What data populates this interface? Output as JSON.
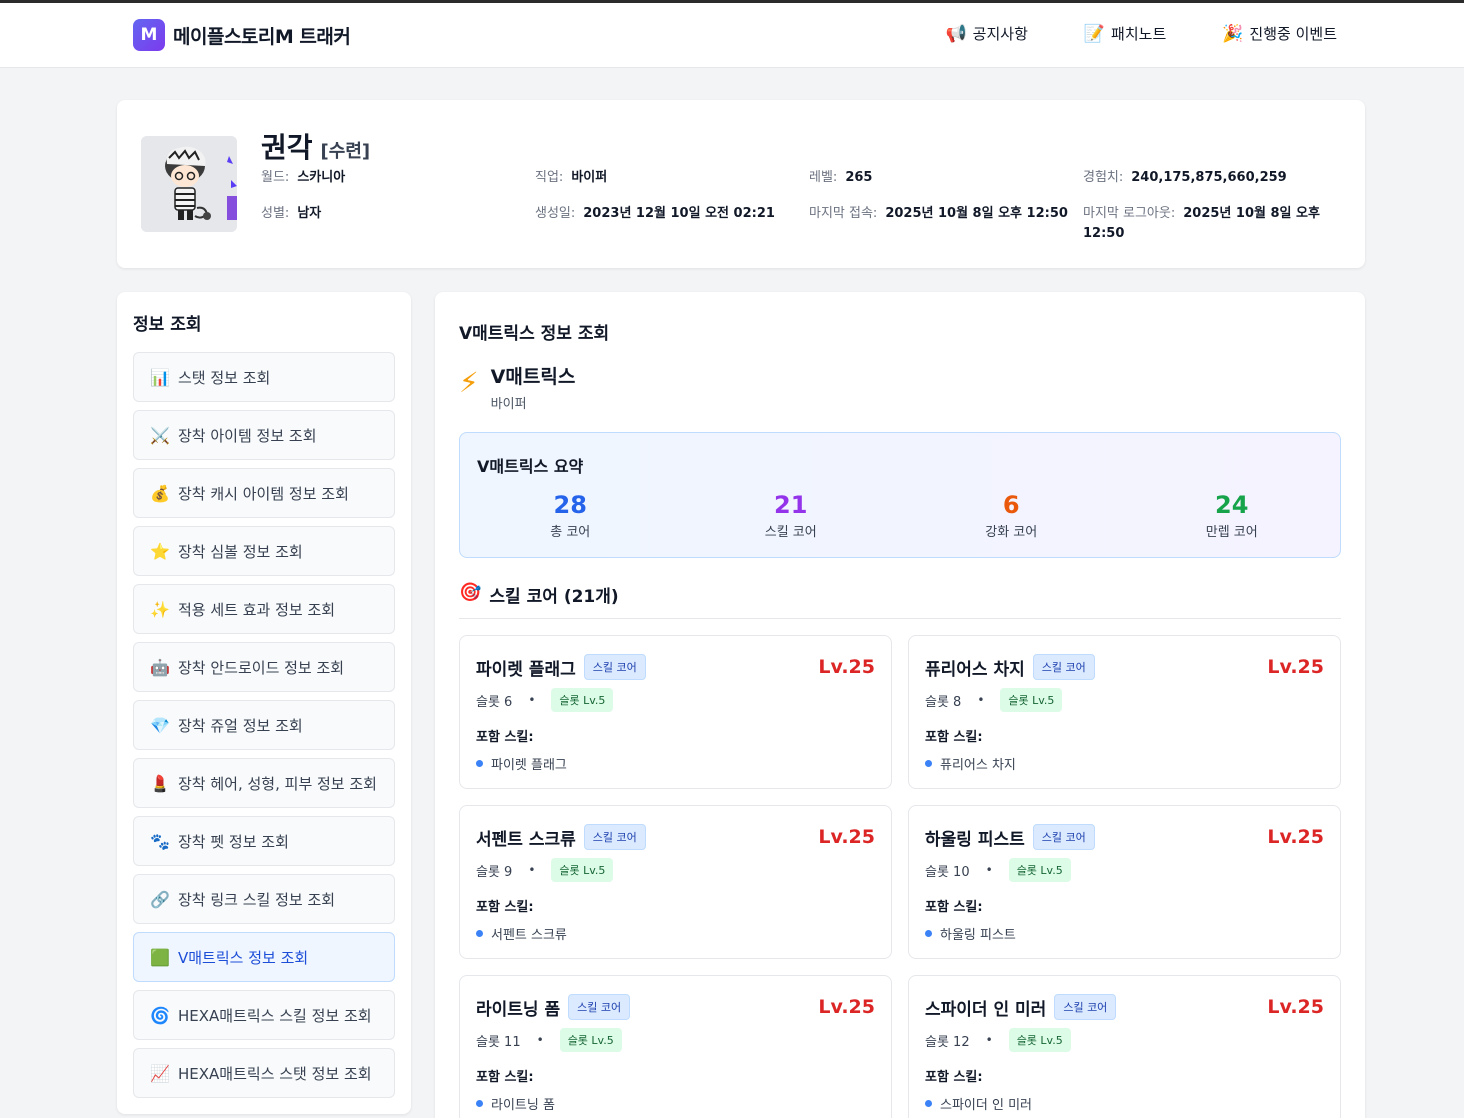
{
  "brand": {
    "logo": "M",
    "name": "메이플스토리M 트래커"
  },
  "nav": [
    {
      "icon": "📢",
      "label": "공지사항"
    },
    {
      "icon": "📝",
      "label": "패치노트"
    },
    {
      "icon": "🎉",
      "label": "진행중 이벤트"
    }
  ],
  "profile": {
    "name": "권각",
    "guild": "[수련]",
    "fields": [
      {
        "label": "월드:",
        "value": "스카니아"
      },
      {
        "label": "직업:",
        "value": "바이퍼"
      },
      {
        "label": "레벨:",
        "value": "265"
      },
      {
        "label": "경험치:",
        "value": "240,175,875,660,259"
      },
      {
        "label": "성별:",
        "value": "남자"
      },
      {
        "label": "생성일:",
        "value": "2023년 12월 10일 오전 02:21"
      },
      {
        "label": "마지막 접속:",
        "value": "2025년 10월 8일 오후 12:50"
      },
      {
        "label": "마지막 로그아웃:",
        "value": "2025년 10월 8일 오후 12:50"
      }
    ]
  },
  "sidebar": {
    "title": "정보 조회",
    "items": [
      {
        "icon": "📊",
        "label": "스탯 정보 조회"
      },
      {
        "icon": "⚔️",
        "label": "장착 아이템 정보 조회"
      },
      {
        "icon": "💰",
        "label": "장착 캐시 아이템 정보 조회"
      },
      {
        "icon": "⭐",
        "label": "장착 심볼 정보 조회"
      },
      {
        "icon": "✨",
        "label": "적용 세트 효과 정보 조회"
      },
      {
        "icon": "🤖",
        "label": "장착 안드로이드 정보 조회"
      },
      {
        "icon": "💎",
        "label": "장착 쥬얼 정보 조회"
      },
      {
        "icon": "💄",
        "label": "장착 헤어, 성형, 피부 정보 조회"
      },
      {
        "icon": "🐾",
        "label": "장착 펫 정보 조회"
      },
      {
        "icon": "🔗",
        "label": "장착 링크 스킬 정보 조회"
      },
      {
        "icon": "🟩",
        "label": "V매트릭스 정보 조회",
        "active": true
      },
      {
        "icon": "🌀",
        "label": "HEXA매트릭스 스킬 정보 조회"
      },
      {
        "icon": "📈",
        "label": "HEXA매트릭스 스탯 정보 조회"
      }
    ]
  },
  "main": {
    "title": "V매트릭스 정보 조회",
    "vm_title": "V매트릭스",
    "vm_sub": "바이퍼",
    "summary": {
      "title": "V매트릭스 요약",
      "stats": [
        {
          "value": "28",
          "label": "총 코어",
          "color": "#2563eb"
        },
        {
          "value": "21",
          "label": "스킬 코어",
          "color": "#9333ea"
        },
        {
          "value": "6",
          "label": "강화 코어",
          "color": "#ea580c"
        },
        {
          "value": "24",
          "label": "만렙 코어",
          "color": "#16a34a"
        }
      ]
    },
    "section_icon": "🎯",
    "section_title": "스킬 코어 (21개)",
    "cores": [
      {
        "name": "파이렛 플래그",
        "type": "스킬 코어",
        "level": "Lv.25",
        "slot": "슬롯 6",
        "slot_level": "슬롯 Lv.5",
        "skills_label": "포함 스킬:",
        "skill": "파이렛 플래그"
      },
      {
        "name": "퓨리어스 차지",
        "type": "스킬 코어",
        "level": "Lv.25",
        "slot": "슬롯 8",
        "slot_level": "슬롯 Lv.5",
        "skills_label": "포함 스킬:",
        "skill": "퓨리어스 차지"
      },
      {
        "name": "서펜트 스크류",
        "type": "스킬 코어",
        "level": "Lv.25",
        "slot": "슬롯 9",
        "slot_level": "슬롯 Lv.5",
        "skills_label": "포함 스킬:",
        "skill": "서펜트 스크류"
      },
      {
        "name": "하울링 피스트",
        "type": "스킬 코어",
        "level": "Lv.25",
        "slot": "슬롯 10",
        "slot_level": "슬롯 Lv.5",
        "skills_label": "포함 스킬:",
        "skill": "하울링 피스트"
      },
      {
        "name": "라이트닝 폼",
        "type": "스킬 코어",
        "level": "Lv.25",
        "slot": "슬롯 11",
        "slot_level": "슬롯 Lv.5",
        "skills_label": "포함 스킬:",
        "skill": "라이트닝 폼"
      },
      {
        "name": "스파이더 인 미러",
        "type": "스킬 코어",
        "level": "Lv.25",
        "slot": "슬롯 12",
        "slot_level": "슬롯 Lv.5",
        "skills_label": "포함 스킬:",
        "skill": "스파이더 인 미러"
      }
    ]
  }
}
